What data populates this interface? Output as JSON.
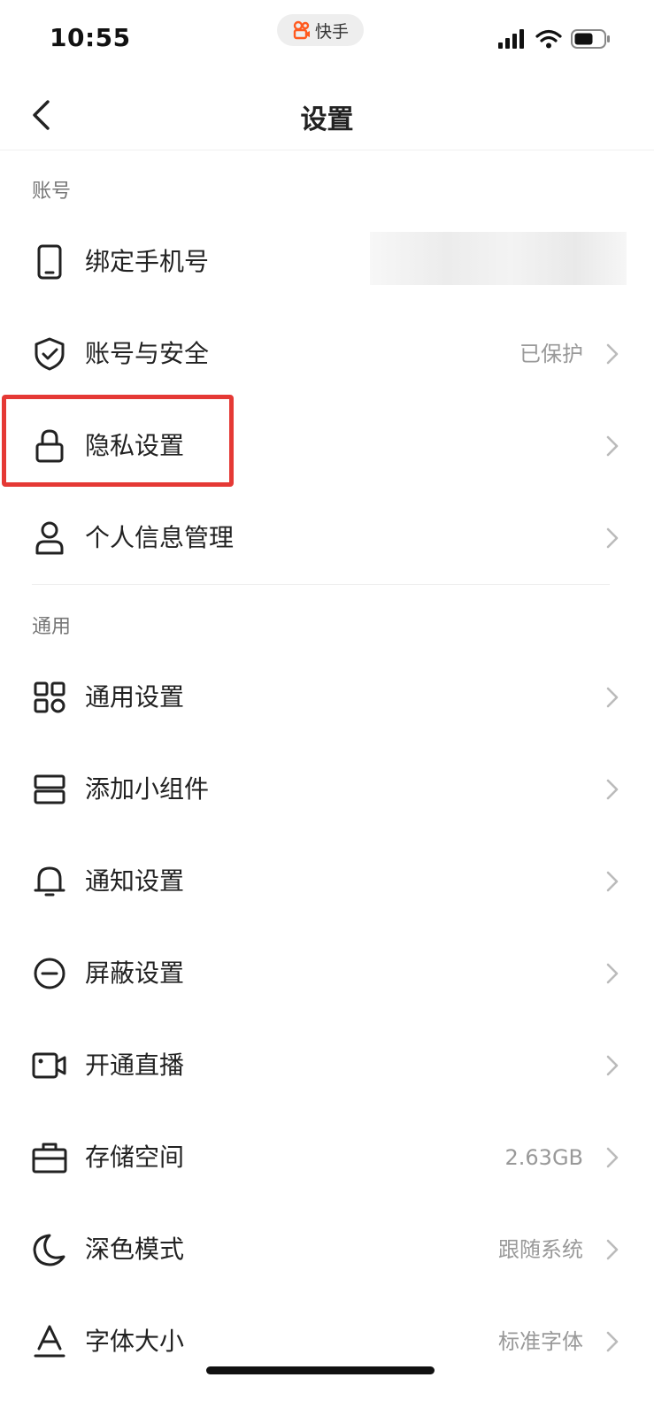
{
  "status_bar": {
    "time": "10:55",
    "app_pill_label": "快手",
    "accent_color": "#ff5a1f"
  },
  "nav": {
    "title": "设置",
    "back_icon": "chevron-left-icon"
  },
  "sections": {
    "account": {
      "header": "账号",
      "items": [
        {
          "label": "绑定手机号",
          "icon": "phone-icon",
          "value": ""
        },
        {
          "label": "账号与安全",
          "icon": "shield-check-icon",
          "value": "已保护"
        },
        {
          "label": "隐私设置",
          "icon": "lock-icon",
          "value": ""
        },
        {
          "label": "个人信息管理",
          "icon": "user-icon",
          "value": ""
        }
      ]
    },
    "general": {
      "header": "通用",
      "items": [
        {
          "label": "通用设置",
          "icon": "grid-icon",
          "value": ""
        },
        {
          "label": "添加小组件",
          "icon": "widget-icon",
          "value": ""
        },
        {
          "label": "通知设置",
          "icon": "bell-icon",
          "value": ""
        },
        {
          "label": "屏蔽设置",
          "icon": "block-icon",
          "value": ""
        },
        {
          "label": "开通直播",
          "icon": "video-camera-icon",
          "value": ""
        },
        {
          "label": "存储空间",
          "icon": "storage-box-icon",
          "value": "2.63GB"
        },
        {
          "label": "深色模式",
          "icon": "moon-icon",
          "value": "跟随系统"
        },
        {
          "label": "字体大小",
          "icon": "font-icon",
          "value": "标准字体"
        }
      ]
    }
  },
  "highlight_color": "#e53935"
}
